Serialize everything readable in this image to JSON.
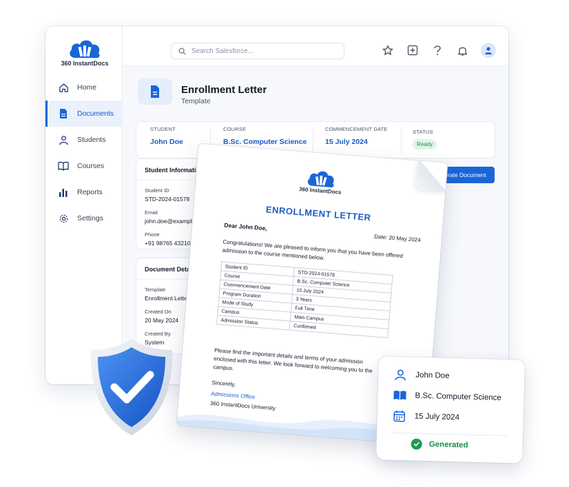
{
  "brand": {
    "name": "360 InstantDocs",
    "accent": "#1a66d8"
  },
  "search": {
    "placeholder": "Search Salesforce..."
  },
  "sidebar": {
    "items": [
      {
        "label": "Home",
        "icon": "home-icon",
        "active": false
      },
      {
        "label": "Documents",
        "icon": "document-icon",
        "active": true
      },
      {
        "label": "Students",
        "icon": "user-icon",
        "active": false
      },
      {
        "label": "Courses",
        "icon": "book-icon",
        "active": false
      },
      {
        "label": "Reports",
        "icon": "bar-chart-icon",
        "active": false
      },
      {
        "label": "Settings",
        "icon": "gear-icon",
        "active": false
      }
    ]
  },
  "topbar": {
    "icons": [
      "star-icon",
      "plus-square-icon",
      "help-icon",
      "bell-icon",
      "avatar-icon"
    ]
  },
  "header": {
    "title": "Enrollment Letter",
    "subtitle": "Template"
  },
  "summary": {
    "student_label": "STUDENT",
    "student_value": "John Doe",
    "course_label": "COURSE",
    "course_value": "B.Sc. Computer Science",
    "date_label": "COMMENCEMENT DATE",
    "date_value": "15 July 2024",
    "status_label": "STATUS",
    "status_value": "Ready"
  },
  "student_info": {
    "title": "Student Information",
    "id_label": "Student ID",
    "id_value": "STD-2024-01578",
    "email_label": "Email",
    "email_value": "john.doe@example.com",
    "phone_label": "Phone",
    "phone_value": "+91 98765 43210"
  },
  "doc_details": {
    "title": "Document Details",
    "template_label": "Template",
    "template_value": "Enrollment Letter Template",
    "created_on_label": "Created On",
    "created_on_value": "20 May 2024",
    "created_by_label": "Created By",
    "created_by_value": "System"
  },
  "generate_button": {
    "label": "Generate Document"
  },
  "letter": {
    "logo_text": "360 InstantDocs",
    "title": "ENROLLMENT LETTER",
    "greeting": "Dear John Doe,",
    "date": "Date: 20 May 2024",
    "paragraph1": "Congratulations! We are pleased to inform you that you have been offered admission to the course mentioned below.",
    "table": [
      [
        "Student ID",
        "STD-2024-01578"
      ],
      [
        "Course",
        "B.Sc. Computer Science"
      ],
      [
        "Commencement Date",
        "15 July 2024"
      ],
      [
        "Program Duration",
        "3 Years"
      ],
      [
        "Mode of Study",
        "Full Time"
      ],
      [
        "Campus",
        "Main Campus"
      ],
      [
        "Admission Status",
        "Confirmed"
      ]
    ],
    "paragraph2": "Please find the important details and terms of your admission enclosed with this letter. We look forward to welcoming you to the campus.",
    "closing": "Sincerely,",
    "office": "Admissions Office",
    "university": "360 InstantDocs University"
  },
  "info_card": {
    "name": "John Doe",
    "course": "B.Sc. Computer Science",
    "date": "15 July 2024",
    "status": "Generated"
  }
}
